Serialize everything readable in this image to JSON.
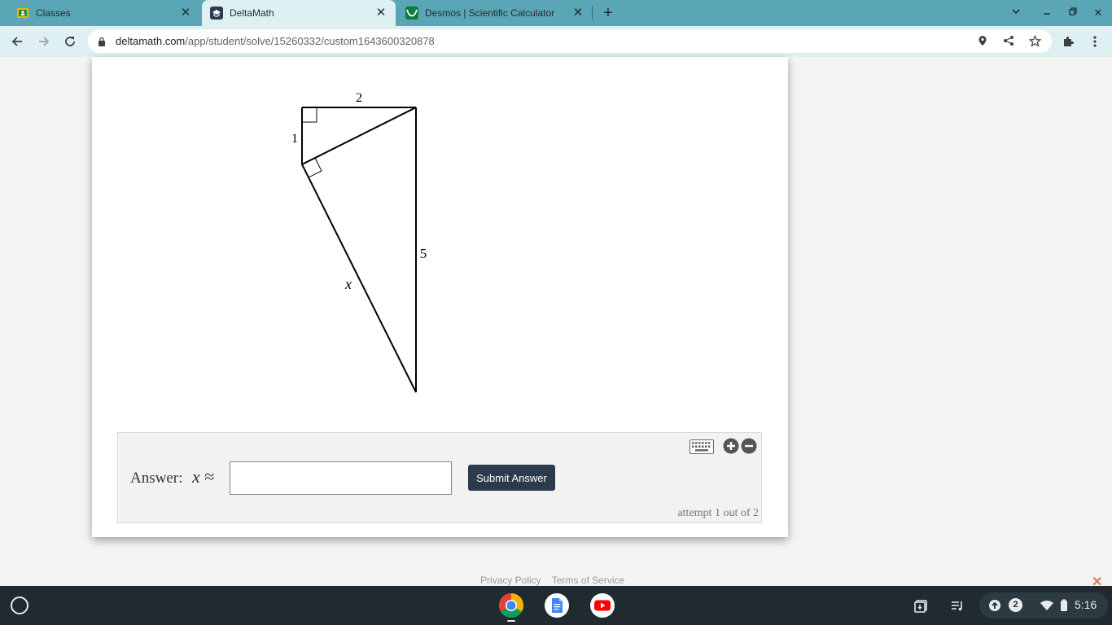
{
  "browser": {
    "tabs": [
      {
        "label": "Classes",
        "active": false
      },
      {
        "label": "DeltaMath",
        "active": true
      },
      {
        "label": "Desmos | Scientific Calculator",
        "active": false
      }
    ],
    "url_domain": "deltamath.com",
    "url_path": "/app/student/solve/15260332/custom1643600320878"
  },
  "diagram": {
    "label_top": "2",
    "label_left": "1",
    "label_right": "5",
    "label_hyp": "x"
  },
  "answer": {
    "label": "Answer:",
    "variable": "x",
    "relation": "≈",
    "input_value": "",
    "submit_label": "Submit Answer",
    "attempt_text": "attempt 1 out of 2"
  },
  "footer": {
    "privacy": "Privacy Policy",
    "terms": "Terms of Service"
  },
  "shelf": {
    "notification_count": "2",
    "clock": "5:16"
  },
  "colors": {
    "tab_strip": "#5aa6b6",
    "toolbar": "#dff0f3",
    "submit_button": "#2c3a4e",
    "shelf": "#1f2b31"
  }
}
